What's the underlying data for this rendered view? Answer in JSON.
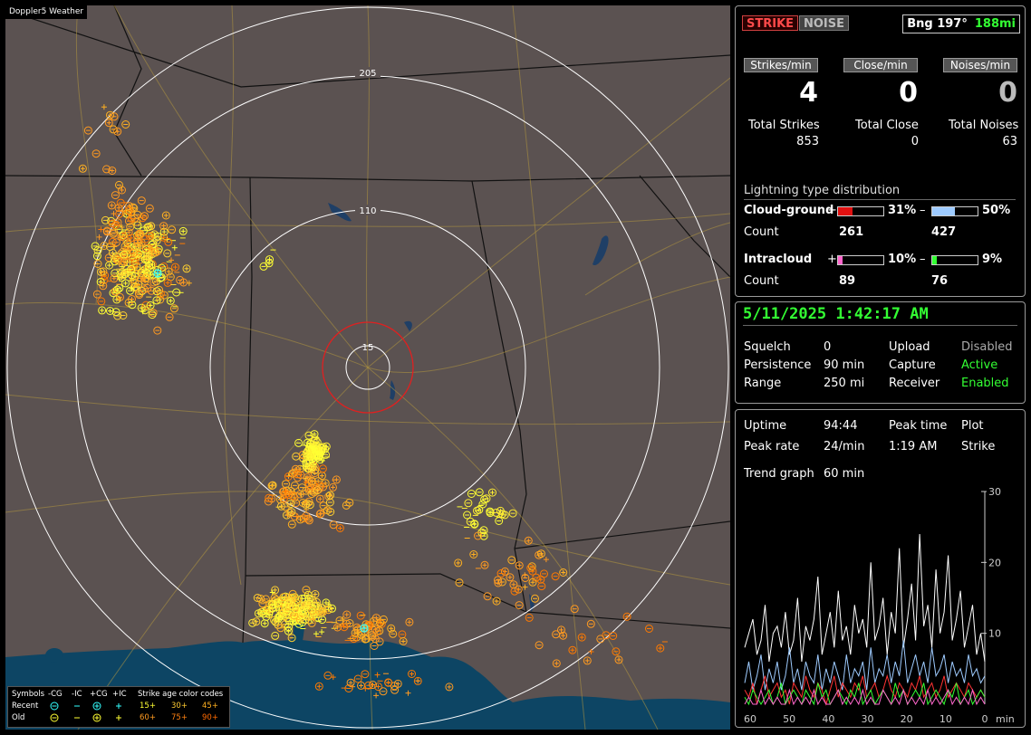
{
  "app": {
    "title": "Doppler5 Weather"
  },
  "colors": {
    "map_land": "#5b5251",
    "map_water": "#0d4564",
    "range_ring": "#ffffff",
    "close_ring": "#e02020",
    "strike_recent": "#ffff33",
    "strike_mid": "#ffb020",
    "strike_old": "#ff7a00",
    "accent_green": "#33ff33"
  },
  "map": {
    "ring_labels": [
      "205",
      "110",
      "15"
    ],
    "legend": {
      "symbols_label": "Symbols",
      "col_neg_cg": "-CG",
      "col_neg_ic": "-IC",
      "col_pos_cg": "+CG",
      "col_pos_ic": "+IC",
      "age_label": "Strike age color codes",
      "recent_label": "Recent",
      "old_label": "Old",
      "age_codes": [
        "15+",
        "30+",
        "45+",
        "60+",
        "75+",
        "90+"
      ]
    }
  },
  "panel1": {
    "strike_button": "STRIKE",
    "noise_button": "NOISE",
    "bearing": "Bng 197°",
    "distance": "188mi",
    "strikes_min_label": "Strikes/min",
    "close_min_label": "Close/min",
    "noises_min_label": "Noises/min",
    "strikes_min": "4",
    "close_min": "0",
    "noises_min": "0",
    "total_strikes_label": "Total Strikes",
    "total_close_label": "Total Close",
    "total_noises_label": "Total Noises",
    "total_strikes": "853",
    "total_close": "0",
    "total_noises": "63",
    "dist_title": "Lightning type distribution",
    "cg_label": "Cloud-ground",
    "ic_label": "Intracloud",
    "count_label": "Count",
    "plus": "+",
    "minus": "–",
    "cg_pos_pct": "31%",
    "cg_neg_pct": "50%",
    "cg_pos_count": "261",
    "cg_neg_count": "427",
    "ic_pos_pct": "10%",
    "ic_neg_pct": "9%",
    "ic_pos_count": "89",
    "ic_neg_count": "76",
    "cg_pos_fill": 0.31,
    "cg_neg_fill": 0.5,
    "ic_pos_fill": 0.1,
    "ic_neg_fill": 0.09
  },
  "panel2": {
    "datetime": "5/11/2025 1:42:17 AM",
    "squelch_label": "Squelch",
    "squelch": "0",
    "persistence_label": "Persistence",
    "persistence": "90 min",
    "range_label": "Range",
    "range": "250 mi",
    "upload_label": "Upload",
    "upload": "Disabled",
    "capture_label": "Capture",
    "capture": "Active",
    "receiver_label": "Receiver",
    "receiver": "Enabled"
  },
  "panel3": {
    "uptime_label": "Uptime",
    "uptime": "94:44",
    "peak_time_label": "Peak time",
    "plot_label": "Plot",
    "peak_rate_label": "Peak rate",
    "peak_rate": "24/min",
    "peak_time": "1:19 AM",
    "plot": "Strike",
    "trend_label": "Trend graph",
    "trend": "60 min"
  },
  "chart_data": {
    "type": "line",
    "xlabel": "min",
    "x_ticks": [
      "60",
      "50",
      "40",
      "30",
      "20",
      "10",
      "0"
    ],
    "y_ticks": [
      "10",
      "20",
      "30"
    ],
    "ylim": [
      0,
      30
    ],
    "xlim": [
      60,
      0
    ],
    "series": [
      {
        "color": "#ffffff",
        "values": [
          8,
          10,
          12,
          7,
          9,
          14,
          6,
          10,
          11,
          8,
          13,
          7,
          9,
          15,
          6,
          11,
          9,
          12,
          18,
          7,
          10,
          13,
          8,
          16,
          9,
          11,
          7,
          14,
          10,
          12,
          8,
          20,
          9,
          11,
          15,
          7,
          13,
          10,
          22,
          8,
          12,
          17,
          9,
          24,
          11,
          14,
          8,
          19,
          10,
          13,
          21,
          9,
          12,
          16,
          8,
          11,
          14,
          7,
          10,
          6
        ]
      },
      {
        "color": "#9ecbff",
        "values": [
          3,
          6,
          2,
          4,
          7,
          2,
          5,
          3,
          6,
          2,
          4,
          8,
          3,
          5,
          2,
          6,
          4,
          3,
          7,
          2,
          5,
          3,
          6,
          4,
          2,
          7,
          3,
          5,
          4,
          6,
          2,
          8,
          3,
          5,
          4,
          7,
          3,
          6,
          4,
          9,
          3,
          5,
          7,
          4,
          6,
          3,
          8,
          4,
          5,
          7,
          3,
          6,
          4,
          5,
          3,
          7,
          4,
          5,
          3,
          4
        ]
      },
      {
        "color": "#ff3333",
        "values": [
          2,
          1,
          3,
          0,
          2,
          4,
          1,
          2,
          3,
          1,
          2,
          0,
          3,
          2,
          1,
          4,
          2,
          1,
          3,
          2,
          0,
          2,
          4,
          1,
          3,
          2,
          1,
          3,
          2,
          4,
          1,
          2,
          3,
          1,
          2,
          4,
          2,
          1,
          3,
          2,
          1,
          3,
          2,
          4,
          1,
          2,
          3,
          1,
          2,
          4,
          1,
          2,
          3,
          2,
          1,
          3,
          2,
          1,
          2,
          1
        ]
      },
      {
        "color": "#33ff33",
        "values": [
          1,
          0,
          2,
          1,
          0,
          1,
          2,
          0,
          1,
          3,
          0,
          1,
          2,
          1,
          0,
          2,
          1,
          0,
          3,
          1,
          2,
          0,
          1,
          2,
          1,
          0,
          2,
          1,
          3,
          0,
          1,
          2,
          0,
          1,
          2,
          1,
          0,
          3,
          1,
          2,
          0,
          1,
          2,
          1,
          3,
          0,
          1,
          2,
          1,
          0,
          2,
          1,
          3,
          0,
          1,
          2,
          0,
          1,
          2,
          1
        ]
      },
      {
        "color": "#ff66cc",
        "values": [
          0,
          1,
          0,
          0,
          2,
          0,
          1,
          0,
          1,
          0,
          0,
          2,
          0,
          1,
          0,
          1,
          0,
          2,
          0,
          1,
          0,
          0,
          1,
          2,
          0,
          1,
          0,
          1,
          0,
          2,
          0,
          1,
          0,
          0,
          2,
          1,
          0,
          1,
          0,
          2,
          0,
          1,
          0,
          1,
          0,
          2,
          0,
          1,
          0,
          1,
          2,
          0,
          1,
          0,
          1,
          0,
          2,
          0,
          1,
          0
        ]
      }
    ]
  }
}
